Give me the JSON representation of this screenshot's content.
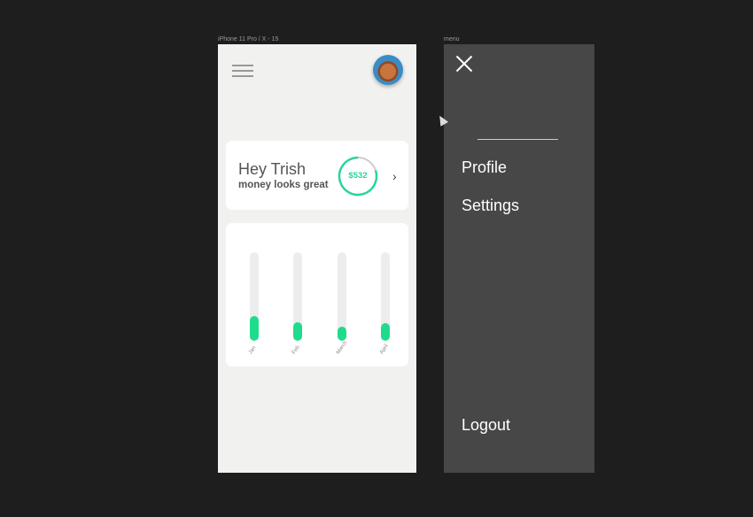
{
  "canvas": {
    "frames": [
      {
        "label": "iPhone 11 Pro / X - 15"
      },
      {
        "label": "menu"
      }
    ]
  },
  "phone": {
    "greeting": "Hey Trish",
    "subtitle": "money looks great",
    "balance": "$532",
    "balance_ring_progress": 0.8,
    "accent_color": "#1fdc8c",
    "chart_data": {
      "type": "bar",
      "categories": [
        "Jan",
        "Feb",
        "March",
        "April"
      ],
      "values": [
        28,
        21,
        16,
        20
      ],
      "ylim": [
        0,
        100
      ]
    }
  },
  "menu": {
    "items": [
      {
        "label": "Profile"
      },
      {
        "label": "Settings"
      }
    ],
    "logout": "Logout"
  }
}
